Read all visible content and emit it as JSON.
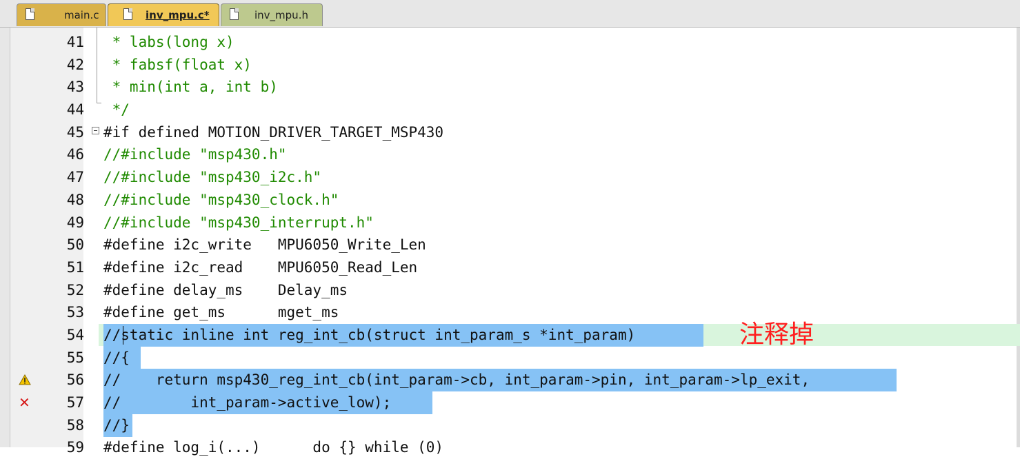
{
  "tabs": [
    {
      "label": "main.c"
    },
    {
      "label": "inv_mpu.c*"
    },
    {
      "label": "inv_mpu.h"
    }
  ],
  "editor": {
    "lines": [
      {
        "num": "41",
        "text": " * labs(long x)"
      },
      {
        "num": "42",
        "text": " * fabsf(float x)"
      },
      {
        "num": "43",
        "text": " * min(int a, int b)"
      },
      {
        "num": "44",
        "text": " */"
      },
      {
        "num": "45",
        "text": "#if defined MOTION_DRIVER_TARGET_MSP430"
      },
      {
        "num": "46",
        "text": "//#include \"msp430.h\""
      },
      {
        "num": "47",
        "text": "//#include \"msp430_i2c.h\""
      },
      {
        "num": "48",
        "text": "//#include \"msp430_clock.h\""
      },
      {
        "num": "49",
        "text": "//#include \"msp430_interrupt.h\""
      },
      {
        "num": "50",
        "text": "#define i2c_write   MPU6050_Write_Len"
      },
      {
        "num": "51",
        "text": "#define i2c_read    MPU6050_Read_Len"
      },
      {
        "num": "52",
        "text": "#define delay_ms    Delay_ms"
      },
      {
        "num": "53",
        "text": "#define get_ms      mget_ms"
      },
      {
        "num": "54",
        "text": "//static inline int reg_int_cb(struct int_param_s *int_param)"
      },
      {
        "num": "55",
        "text": "//{"
      },
      {
        "num": "56",
        "text": "//    return msp430_reg_int_cb(int_param->cb, int_param->pin, int_param->lp_exit,"
      },
      {
        "num": "57",
        "text": "//        int_param->active_low);"
      },
      {
        "num": "58",
        "text": "//}"
      },
      {
        "num": "59",
        "text": "#define log_i(...)      do {} while (0)"
      }
    ],
    "annotation": "注释掉",
    "markers": {
      "line56": "warning-icon",
      "line57": "error-icon"
    }
  },
  "colors": {
    "selection": "#86c2f5",
    "current_line": "#d9f5dd",
    "comment": "#1f8a00",
    "annotation": "#ff1f1f",
    "tab_active": "#f1c857"
  }
}
